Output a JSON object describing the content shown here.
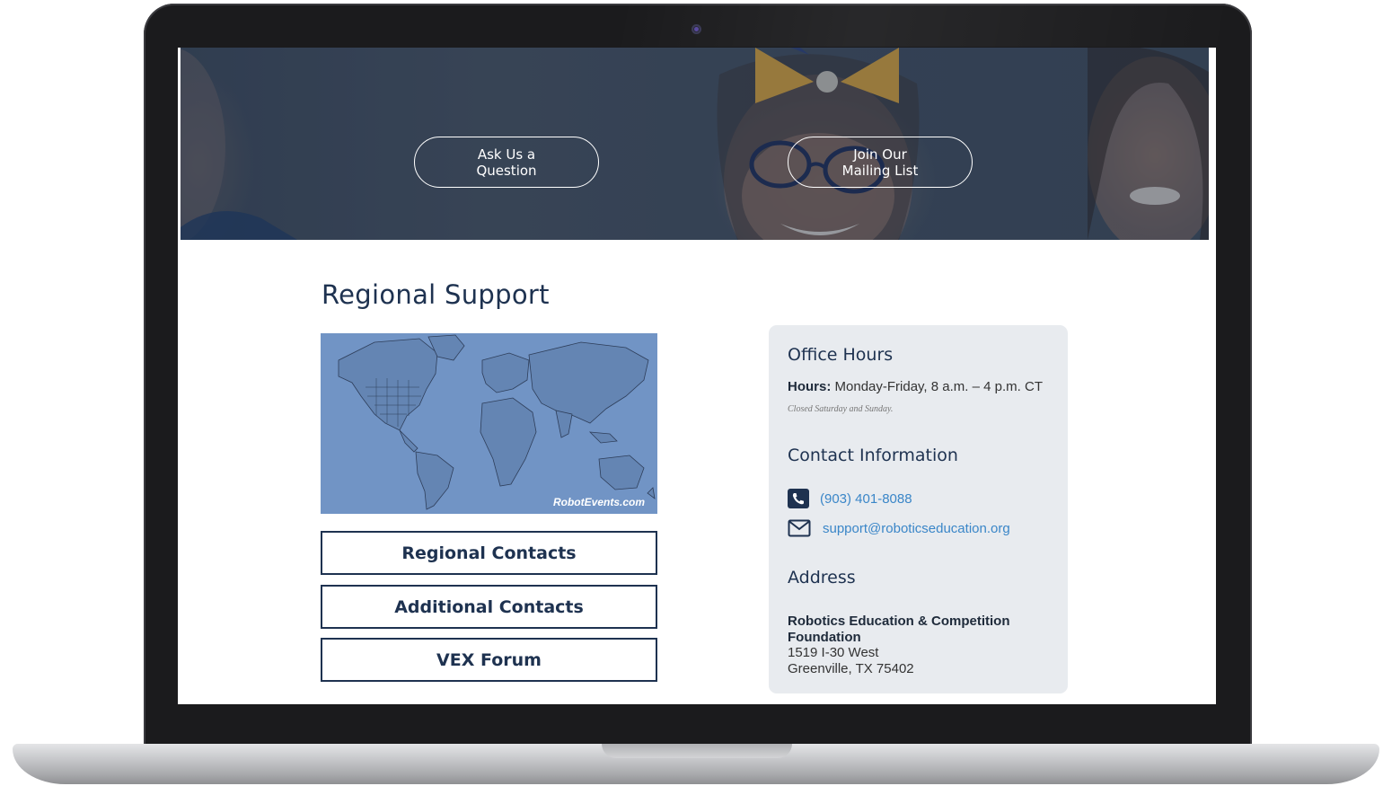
{
  "hero": {
    "ask_button": "Ask Us a\nQuestion",
    "join_button": "Join Our\nMailing List"
  },
  "regional": {
    "title": "Regional Support",
    "map_credit": "RobotEvents.com",
    "buttons": {
      "regional_contacts": "Regional Contacts",
      "additional_contacts": "Additional Contacts",
      "vex_forum": "VEX Forum"
    }
  },
  "office_hours": {
    "heading": "Office Hours",
    "hours_label": "Hours:",
    "hours_value": "Monday-Friday, 8 a.m. – 4 p.m. CT",
    "closed_note": "Closed Saturday and Sunday."
  },
  "contact": {
    "heading": "Contact Information",
    "phone": "(903) 401-8088",
    "email": "support@roboticseducation.org",
    "icons": [
      "phone-icon",
      "envelope-icon"
    ]
  },
  "address": {
    "heading": "Address",
    "org": "Robotics Education & Competition Foundation",
    "street": "1519 I-30 West",
    "city": "Greenville, TX 75402"
  },
  "colors": {
    "navy": "#1e3250",
    "link": "#3a86c8",
    "card_bg": "#e8ebef",
    "map_bg": "#7194c5"
  }
}
